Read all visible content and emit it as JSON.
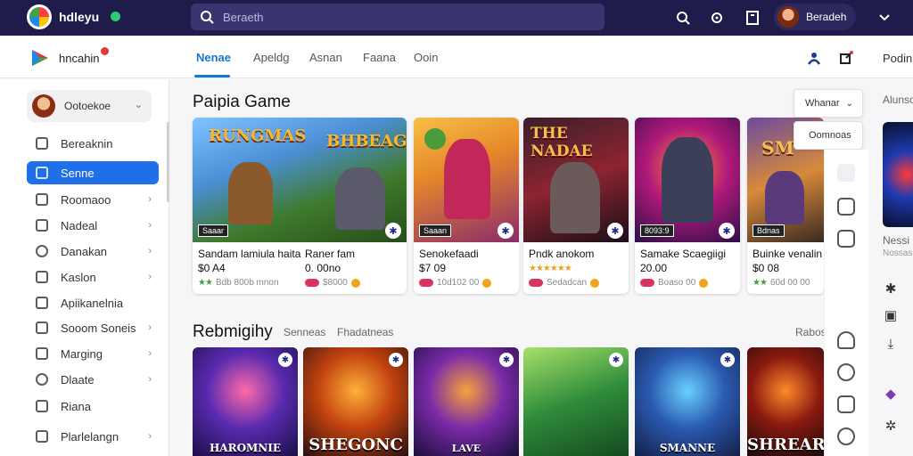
{
  "topbar": {
    "brand": "hdleyu",
    "search_placeholder": "Beraeth",
    "user_name": "Beradeh"
  },
  "navbar": {
    "brand": "hncahin",
    "tabs": [
      {
        "label": "Nenae",
        "active": true
      },
      {
        "label": "Apeldg",
        "active": false
      },
      {
        "label": "Asnan",
        "active": false
      },
      {
        "label": "Faana",
        "active": false
      },
      {
        "label": "Ooin",
        "active": false
      }
    ],
    "right_label": "Podin"
  },
  "sidebar": {
    "profile_name": "Ootoekoe",
    "items": [
      {
        "label": "Bereaknin",
        "active": false,
        "has_chevron": false
      },
      {
        "label": "Senne",
        "active": true,
        "has_chevron": false
      },
      {
        "label": "Roomaoo",
        "active": false,
        "has_chevron": true
      },
      {
        "label": "Nadeal",
        "active": false,
        "has_chevron": true
      },
      {
        "label": "Danakan",
        "active": false,
        "has_chevron": true
      },
      {
        "label": "Kaslon",
        "active": false,
        "has_chevron": true
      },
      {
        "label": "Apiikanelnia",
        "active": false,
        "has_chevron": false
      },
      {
        "label": "Sooom Soneis",
        "active": false,
        "has_chevron": true
      },
      {
        "label": "Marging",
        "active": false,
        "has_chevron": true
      },
      {
        "label": "Dlaate",
        "active": false,
        "has_chevron": true
      },
      {
        "label": "Riana",
        "active": false,
        "has_chevron": false
      },
      {
        "label": "Plarlelangn",
        "active": false,
        "has_chevron": true
      }
    ]
  },
  "section1": {
    "title": "Paipia Game",
    "sort_label": "Whanar",
    "sort_option": "Oomnoas",
    "cards": [
      {
        "art_text": "RUNGMAS",
        "tag": "Saaar",
        "title": "Sandam lamiula haita",
        "price": "$0 A4",
        "meta": "Bdb 800b mnon",
        "rating": "★★"
      },
      {
        "art_text": "BHBEAG",
        "tag": "",
        "title": "Raner fam",
        "price": "0. 00no",
        "meta": "$8000",
        "rating": ""
      },
      {
        "art_text": "",
        "tag": "Saaan",
        "title": "Senokefaadi",
        "price": "$7 09",
        "meta": "10d102 00",
        "rating": ""
      },
      {
        "art_text": "THE NADAE",
        "tag": "",
        "title": "Pndk anokom",
        "price": "",
        "meta": "Sedadcan",
        "rating": "★★★★★★"
      },
      {
        "art_text": "",
        "tag": "8093:9",
        "title": "Samake Scaegiigi",
        "price": "20.00",
        "meta": "Boaso 00",
        "rating": ""
      },
      {
        "art_text": "SM",
        "tag": "Bdnas",
        "title": "Buinke venalin",
        "price": "$0 08",
        "meta": "60d 00 00",
        "rating": "★★"
      }
    ]
  },
  "section2": {
    "title": "Rebmigihy",
    "sub1": "Senneas",
    "sub2": "Fhadatneas",
    "right_label": "Rabos",
    "cards": [
      {
        "brand": "HAROMNIE"
      },
      {
        "brand": "SHEGONC"
      },
      {
        "brand": "LAVE"
      },
      {
        "brand": ""
      },
      {
        "brand": "SMANNE"
      },
      {
        "brand": "SHREAR"
      }
    ]
  },
  "far_right": {
    "label_top": "Alunso",
    "label_mid": "Nessi",
    "label_sub": "Nossas"
  },
  "colors": {
    "topbar": "#1f1b4a",
    "accent": "#1e6fe8",
    "background": "#f6f6f8"
  }
}
